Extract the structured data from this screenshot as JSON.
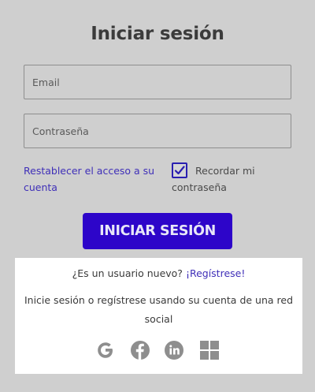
{
  "title": "Iniciar sesión",
  "fields": {
    "email_placeholder": "Email",
    "password_placeholder": "Contraseña"
  },
  "reset_link": "Restablecer el acceso a su cuenta",
  "remember": {
    "label": "Recordar mi contraseña",
    "checked": true
  },
  "login_button": "INICIAR SESIÓN",
  "signup": {
    "question": "¿Es un usuario nuevo?",
    "link": "¡Regístrese!"
  },
  "social": {
    "text": "Inicie sesión o regístrese usando su cuenta de una red social",
    "providers": [
      "google-icon",
      "facebook-icon",
      "linkedin-icon",
      "windows-icon"
    ]
  },
  "colors": {
    "accent": "#2d05c9",
    "link": "#3f2fb8",
    "overlay": "#cfcfcf",
    "panel": "#ffffff",
    "icon": "#8e8e8e"
  }
}
